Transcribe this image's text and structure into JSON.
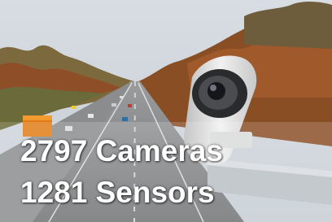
{
  "stats": {
    "cameras_label": "2797 Cameras",
    "sensors_label": "1281 Sensors"
  },
  "colors": {
    "sky": "#cfd6dd",
    "trees_autumn": "#8c5a2e",
    "road": "#7d7f82",
    "camera_housing": "#e6e6e6",
    "text": "#ffffff"
  }
}
